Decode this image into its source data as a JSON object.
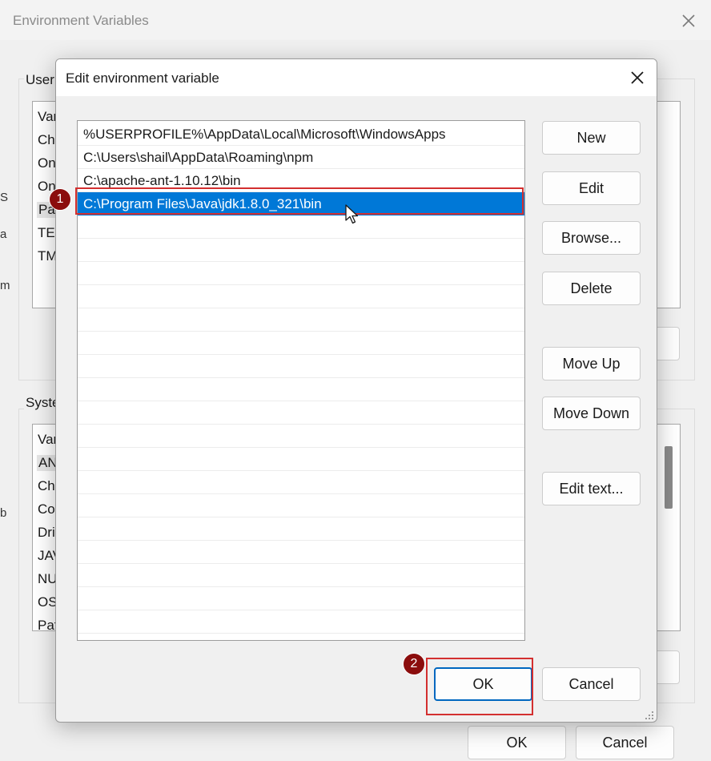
{
  "background_window": {
    "title": "Environment Variables",
    "user_group_label": "User",
    "user_vars": [
      "Var",
      "Ch",
      "On",
      "On",
      "Pa",
      "TE",
      "TM"
    ],
    "system_group_label": "Syste",
    "system_vars": [
      "Var",
      "AN",
      "Ch",
      "Co",
      "Dri",
      "JAV",
      "NU",
      "OS",
      "Pat"
    ],
    "edge_chars": [
      "S",
      "a",
      "m",
      "b"
    ],
    "ok_label": "OK",
    "cancel_label": "Cancel"
  },
  "dialog": {
    "title": "Edit environment variable",
    "paths": [
      "%USERPROFILE%\\AppData\\Local\\Microsoft\\WindowsApps",
      "C:\\Users\\shail\\AppData\\Roaming\\npm",
      "C:\\apache-ant-1.10.12\\bin",
      "C:\\Program Files\\Java\\jdk1.8.0_321\\bin"
    ],
    "selected_index": 3,
    "buttons": {
      "new": "New",
      "edit": "Edit",
      "browse": "Browse...",
      "delete": "Delete",
      "move_up": "Move Up",
      "move_down": "Move Down",
      "edit_text": "Edit text...",
      "ok": "OK",
      "cancel": "Cancel"
    }
  },
  "annotations": {
    "step1": "1",
    "step2": "2",
    "highlight_color": "#d32f2f",
    "badge_color": "#8b0d0d"
  },
  "colors": {
    "selection": "#0078d7",
    "dialog_bg": "#f0f0f0"
  }
}
